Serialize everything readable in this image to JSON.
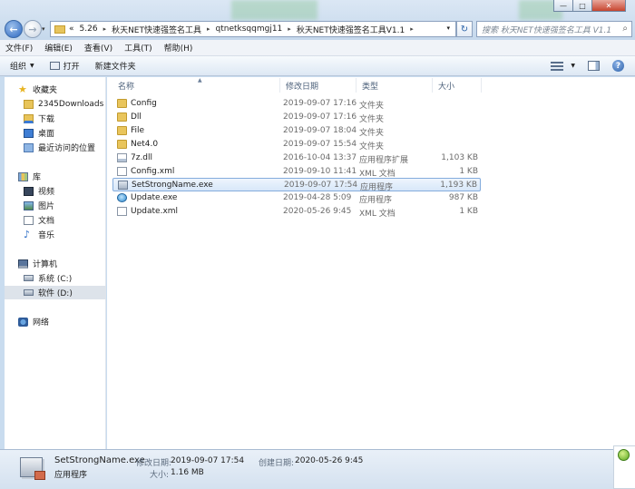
{
  "window": {
    "minimize_glyph": "—",
    "maximize_glyph": "□",
    "close_glyph": "✕"
  },
  "address": {
    "overflow": "«",
    "crumbs": [
      "5.26",
      "秋天NET快速强签名工具",
      "qtnetksqqmgj11",
      "秋天NET快速强签名工具V1.1"
    ],
    "separator": "▸",
    "dropdown": "▾",
    "refresh_glyph": "↻"
  },
  "search": {
    "placeholder": "搜索 秋天NET快速强签名工具 V1.1",
    "icon": "search-icon"
  },
  "menu": [
    "文件(F)",
    "编辑(E)",
    "查看(V)",
    "工具(T)",
    "帮助(H)"
  ],
  "toolbar": {
    "organize": "组织",
    "open": "打开",
    "new_folder": "新建文件夹",
    "help": "?"
  },
  "nav": [
    {
      "label": "收藏夹",
      "icon": "star-icon"
    },
    {
      "label": "2345Downloads",
      "icon": "folder-icon"
    },
    {
      "label": "下载",
      "icon": "download-folder-icon"
    },
    {
      "label": "桌面",
      "icon": "desktop-icon"
    },
    {
      "label": "最近访问的位置",
      "icon": "recent-places-icon"
    },
    {
      "label": "库",
      "icon": "library-icon"
    },
    {
      "label": "视频",
      "icon": "video-icon"
    },
    {
      "label": "图片",
      "icon": "pictures-icon"
    },
    {
      "label": "文档",
      "icon": "documents-icon"
    },
    {
      "label": "音乐",
      "icon": "music-icon"
    },
    {
      "label": "计算机",
      "icon": "computer-icon"
    },
    {
      "label": "系统 (C:)",
      "icon": "drive-icon"
    },
    {
      "label": "软件 (D:)",
      "icon": "drive-icon"
    },
    {
      "label": "网络",
      "icon": "network-icon"
    }
  ],
  "columns": {
    "name": "名称",
    "date": "修改日期",
    "type": "类型",
    "size": "大小"
  },
  "files": [
    {
      "name": "Config",
      "date": "2019-09-07 17:16",
      "type": "文件夹",
      "size": "",
      "icon": "folder-icon"
    },
    {
      "name": "Dll",
      "date": "2019-09-07 17:16",
      "type": "文件夹",
      "size": "",
      "icon": "folder-icon"
    },
    {
      "name": "File",
      "date": "2019-09-07 18:04",
      "type": "文件夹",
      "size": "",
      "icon": "folder-icon"
    },
    {
      "name": "Net4.0",
      "date": "2019-09-07 15:54",
      "type": "文件夹",
      "size": "",
      "icon": "folder-icon"
    },
    {
      "name": "7z.dll",
      "date": "2016-10-04 13:37",
      "type": "应用程序扩展",
      "size": "1,103 KB",
      "icon": "dll-file-icon"
    },
    {
      "name": "Config.xml",
      "date": "2019-09-10 11:41",
      "type": "XML 文档",
      "size": "1 KB",
      "icon": "xml-file-icon"
    },
    {
      "name": "SetStrongName.exe",
      "date": "2019-09-07 17:54",
      "type": "应用程序",
      "size": "1,193 KB",
      "icon": "exe-file-icon"
    },
    {
      "name": "Update.exe",
      "date": "2019-04-28 5:09",
      "type": "应用程序",
      "size": "987 KB",
      "icon": "update-exe-icon"
    },
    {
      "name": "Update.xml",
      "date": "2020-05-26 9:45",
      "type": "XML 文档",
      "size": "1 KB",
      "icon": "xml-file-icon"
    }
  ],
  "details": {
    "name": "SetStrongName.exe",
    "type": "应用程序",
    "modified_label": "修改日期:",
    "modified": "2019-09-07 17:54",
    "created_label": "创建日期:",
    "created": "2020-05-26 9:45",
    "size_label": "大小:",
    "size": "1.16 MB"
  }
}
